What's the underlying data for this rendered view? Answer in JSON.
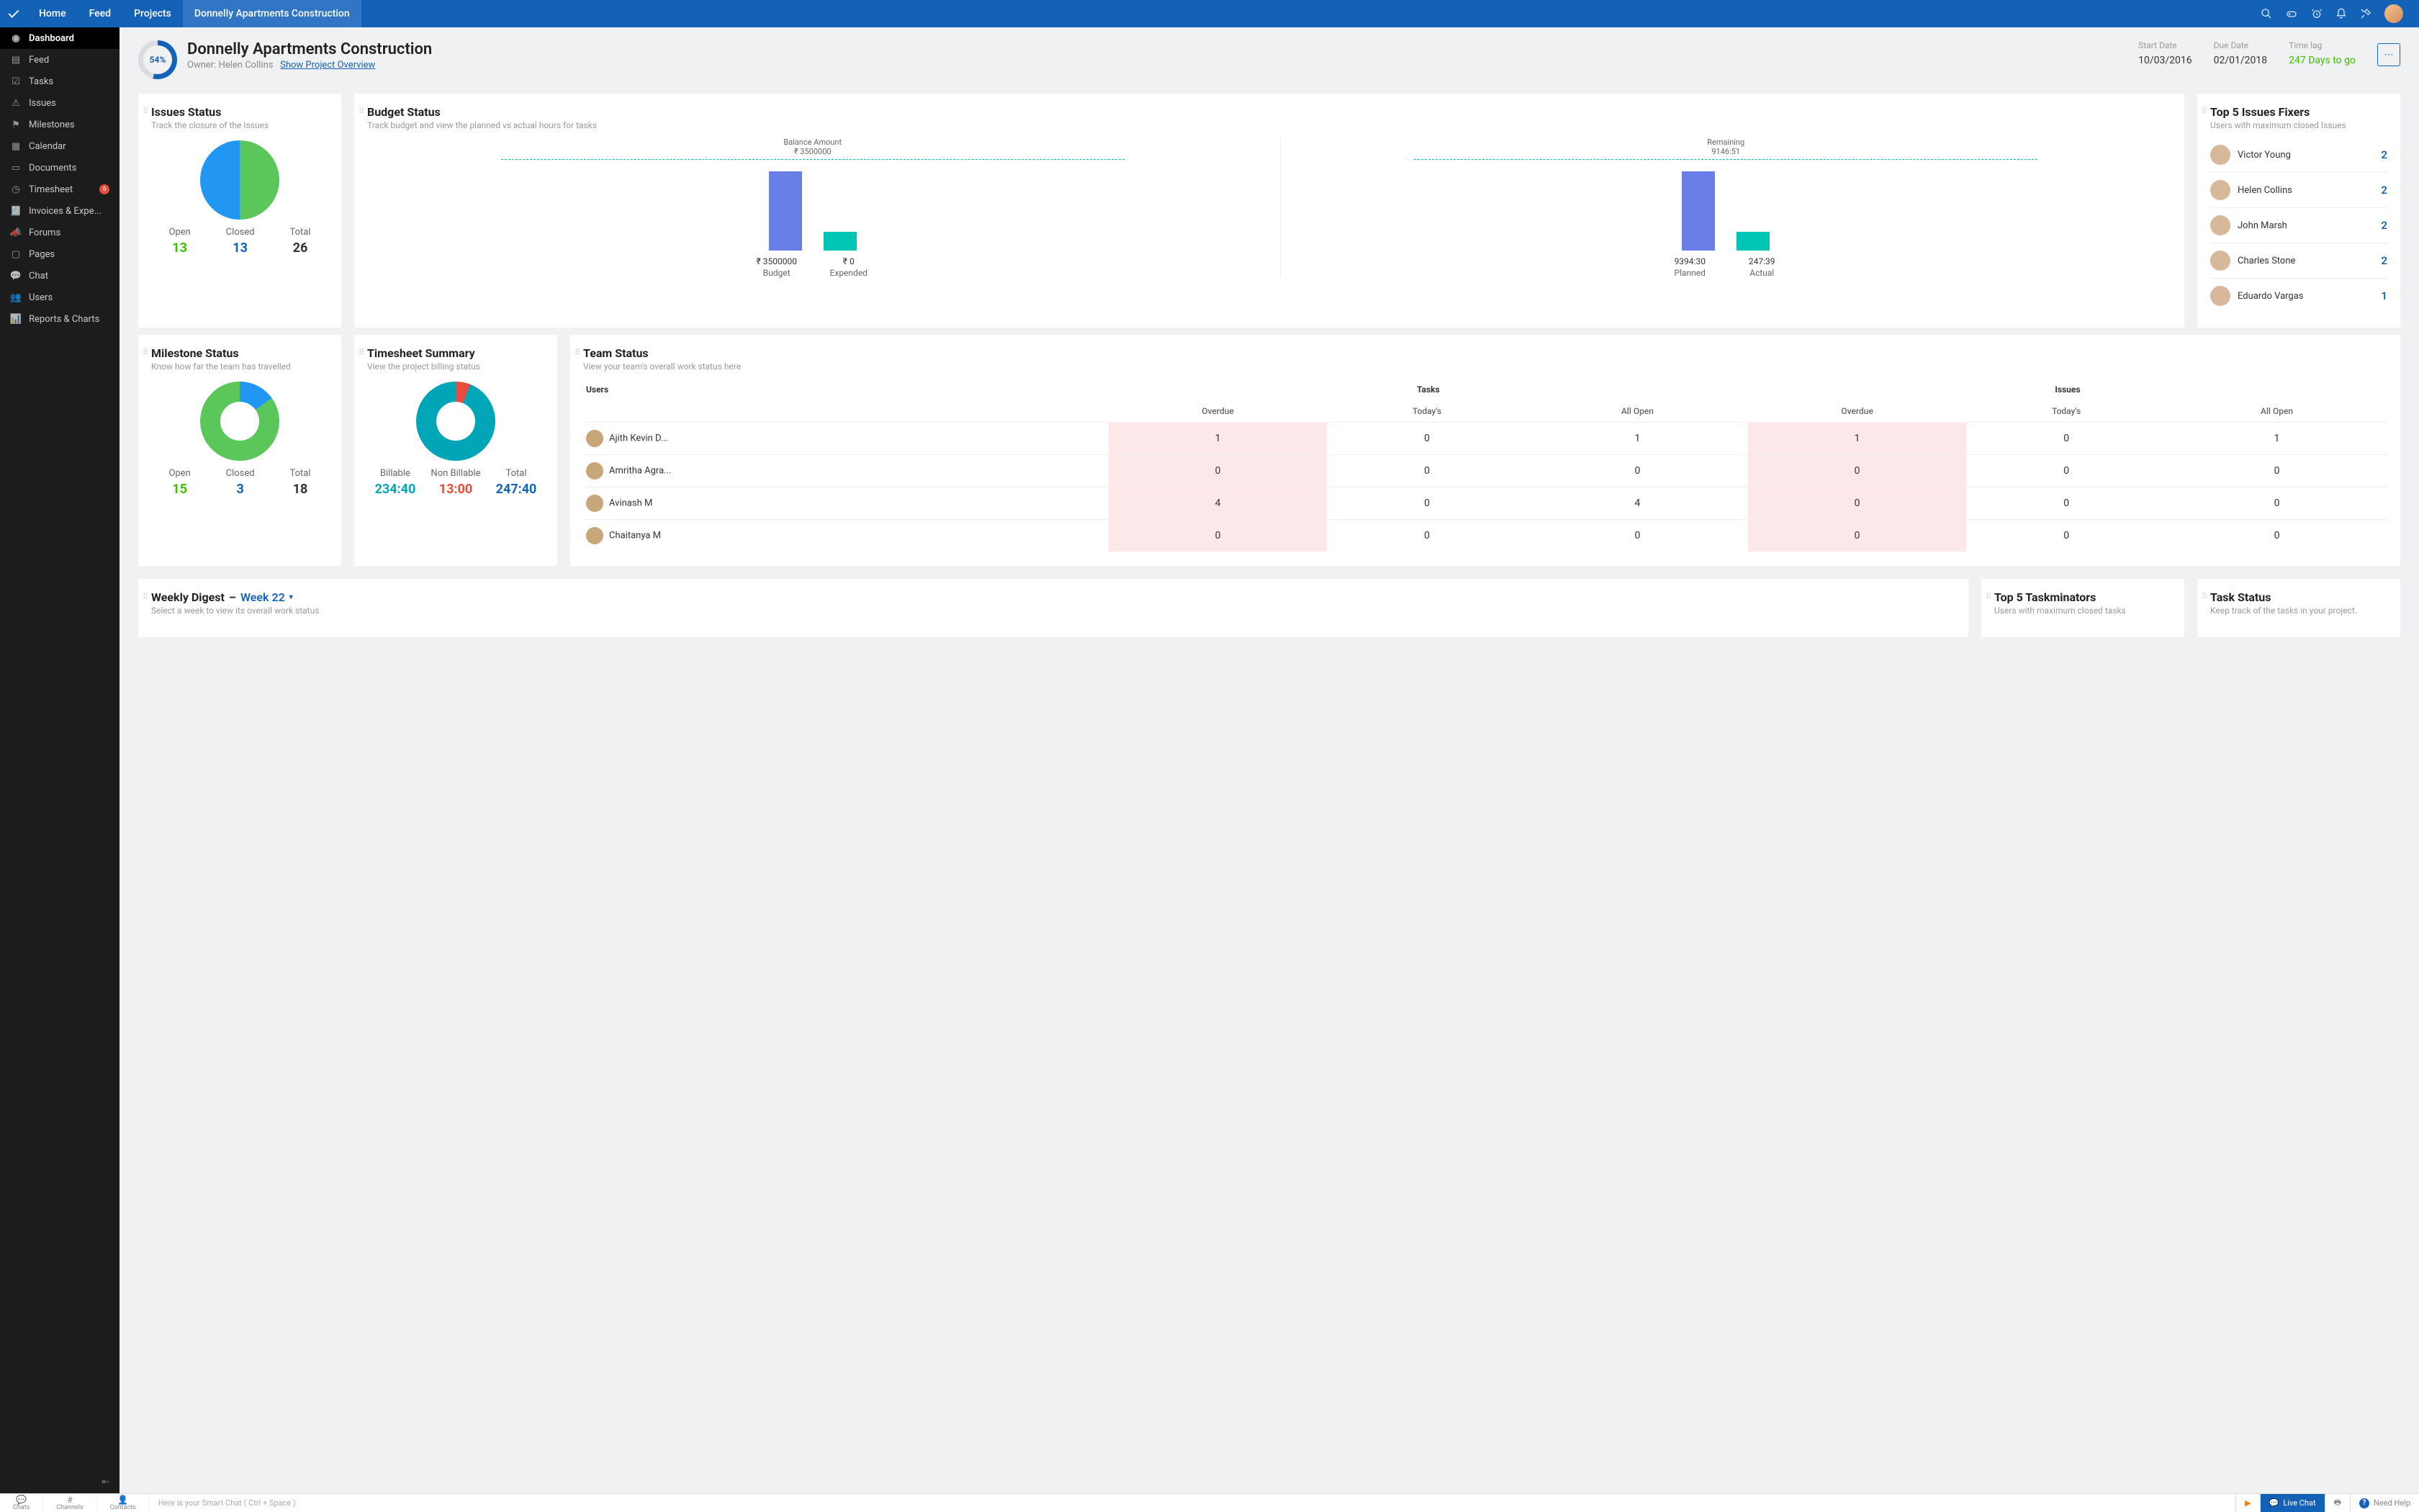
{
  "topnav": {
    "links": [
      "Home",
      "Feed",
      "Projects",
      "Donnelly Apartments Construction"
    ],
    "active_index": 3
  },
  "sidebar": {
    "items": [
      {
        "label": "Dashboard",
        "active": true
      },
      {
        "label": "Feed"
      },
      {
        "label": "Tasks"
      },
      {
        "label": "Issues"
      },
      {
        "label": "Milestones"
      },
      {
        "label": "Calendar"
      },
      {
        "label": "Documents"
      },
      {
        "label": "Timesheet",
        "badge": "6"
      },
      {
        "label": "Invoices & Expe..."
      },
      {
        "label": "Forums"
      },
      {
        "label": "Pages"
      },
      {
        "label": "Chat"
      },
      {
        "label": "Users"
      },
      {
        "label": "Reports & Charts"
      }
    ]
  },
  "project": {
    "percent": "54%",
    "title": "Donnelly Apartments Construction",
    "owner_label": "Owner:",
    "owner": "Helen Collins",
    "overview_link": "Show Project Overview",
    "meta": {
      "start_label": "Start Date",
      "start": "10/03/2016",
      "due_label": "Due Date",
      "due": "02/01/2018",
      "lag_label": "Time lag",
      "lag": "247 Days to go"
    }
  },
  "issues_status": {
    "title": "Issues Status",
    "sub": "Track the closure of the Issues",
    "stats": [
      {
        "label": "Open",
        "value": "13",
        "cls": "green"
      },
      {
        "label": "Closed",
        "value": "13",
        "cls": "blue"
      },
      {
        "label": "Total",
        "value": "26",
        "cls": ""
      }
    ]
  },
  "budget": {
    "title": "Budget Status",
    "sub": "Track budget and view the planned vs actual hours for tasks",
    "panel1": {
      "anno_label": "Balance Amount",
      "anno_val": "₹ 3500000",
      "bar1_val": "₹ 3500000",
      "bar1_cap": "Budget",
      "bar2_val": "₹ 0",
      "bar2_cap": "Expended"
    },
    "panel2": {
      "anno_label": "Remaining",
      "anno_val": "9146:51",
      "bar1_val": "9394:30",
      "bar1_cap": "Planned",
      "bar2_val": "247:39",
      "bar2_cap": "Actual"
    }
  },
  "top_fixers": {
    "title": "Top 5 Issues Fixers",
    "sub": "Users with maximum closed Issues",
    "list": [
      {
        "name": "Victor Young",
        "count": "2"
      },
      {
        "name": "Helen Collins",
        "count": "2"
      },
      {
        "name": "John Marsh",
        "count": "2"
      },
      {
        "name": "Charles Stone",
        "count": "2"
      },
      {
        "name": "Eduardo Vargas",
        "count": "1"
      }
    ]
  },
  "milestone": {
    "title": "Milestone Status",
    "sub": "Know how far the team has travelled",
    "stats": [
      {
        "label": "Open",
        "value": "15",
        "cls": "green"
      },
      {
        "label": "Closed",
        "value": "3",
        "cls": "blue"
      },
      {
        "label": "Total",
        "value": "18",
        "cls": ""
      }
    ]
  },
  "timesheet": {
    "title": "Timesheet Summary",
    "sub": "View the project billing status",
    "stats": [
      {
        "label": "Billable",
        "value": "234:40",
        "cls": "teal"
      },
      {
        "label": "Non Billable",
        "value": "13:00",
        "cls": "red"
      },
      {
        "label": "Total",
        "value": "247:40",
        "cls": "blue"
      }
    ]
  },
  "team": {
    "title": "Team Status",
    "sub": "View your team's overall work status here",
    "headers": {
      "users": "Users",
      "tasks": "Tasks",
      "issues": "Issues",
      "overdue": "Overdue",
      "todays": "Today's",
      "allopen": "All Open"
    },
    "rows": [
      {
        "name": "Ajith Kevin D...",
        "t_overdue": "1",
        "t_today": "0",
        "t_open": "1",
        "i_overdue": "1",
        "i_today": "0",
        "i_open": "1"
      },
      {
        "name": "Amritha Agra...",
        "t_overdue": "0",
        "t_today": "0",
        "t_open": "0",
        "i_overdue": "0",
        "i_today": "0",
        "i_open": "0"
      },
      {
        "name": "Avinash M",
        "t_overdue": "4",
        "t_today": "0",
        "t_open": "4",
        "i_overdue": "0",
        "i_today": "0",
        "i_open": "0"
      },
      {
        "name": "Chaitanya M",
        "t_overdue": "0",
        "t_today": "0",
        "t_open": "0",
        "i_overdue": "0",
        "i_today": "0",
        "i_open": "0"
      }
    ]
  },
  "weekly": {
    "title": "Weekly Digest",
    "link": "Week 22",
    "sub": "Select a week to view its overall work status"
  },
  "taskminators": {
    "title": "Top 5 Taskminators",
    "sub": "Users with maximum closed tasks"
  },
  "task_status": {
    "title": "Task Status",
    "sub": "Keep track of the tasks in your project."
  },
  "bottom": {
    "chats": "Chats",
    "channels": "Channels",
    "contacts": "Contacts",
    "smart": "Here is your Smart Chat ( Ctrl + Space )",
    "live": "Live Chat",
    "help": "Need Help"
  },
  "chart_data": [
    {
      "type": "pie",
      "title": "Issues Status",
      "categories": [
        "Open",
        "Closed"
      ],
      "values": [
        13,
        13
      ],
      "colors": [
        "#5bc75b",
        "#2196f3"
      ]
    },
    {
      "type": "bar",
      "title": "Budget Status – Cost",
      "categories": [
        "Budget",
        "Expended"
      ],
      "values": [
        3500000,
        0
      ],
      "annotations": [
        {
          "label": "Balance Amount",
          "value": 3500000
        }
      ],
      "ylabel": "₹"
    },
    {
      "type": "bar",
      "title": "Budget Status – Hours",
      "categories": [
        "Planned",
        "Actual"
      ],
      "values": [
        9394.5,
        247.65
      ],
      "value_labels": [
        "9394:30",
        "247:39"
      ],
      "annotations": [
        {
          "label": "Remaining",
          "value_label": "9146:51"
        }
      ],
      "ylabel": "Hours"
    },
    {
      "type": "pie",
      "title": "Milestone Status",
      "categories": [
        "Open",
        "Closed"
      ],
      "values": [
        15,
        3
      ],
      "colors": [
        "#5bc75b",
        "#2196f3"
      ],
      "donut": true
    },
    {
      "type": "pie",
      "title": "Timesheet Summary",
      "categories": [
        "Billable",
        "Non Billable"
      ],
      "values": [
        234.67,
        13.0
      ],
      "value_labels": [
        "234:40",
        "13:00"
      ],
      "colors": [
        "#00a6b8",
        "#e74c3c"
      ],
      "donut": true
    }
  ]
}
